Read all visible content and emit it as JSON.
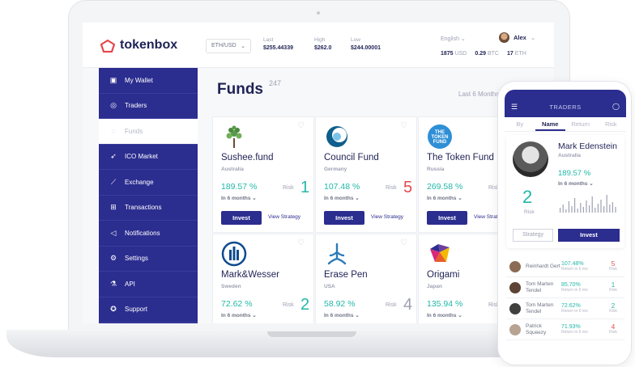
{
  "app": {
    "logo_text": "tokenbox"
  },
  "topbar": {
    "currency_pair": "ETH/USD",
    "stats": [
      {
        "label": "Last",
        "value": "$255.44339"
      },
      {
        "label": "High",
        "value": "$262.0"
      },
      {
        "label": "Low",
        "value": "$244.00001"
      }
    ],
    "language": "English",
    "user_name": "Alex",
    "balances": [
      {
        "amount": "1875",
        "unit": "USD"
      },
      {
        "amount": "0.29",
        "unit": "BTC"
      },
      {
        "amount": "17",
        "unit": "ETH"
      }
    ]
  },
  "sidebar": {
    "items": [
      {
        "label": "My Wallet",
        "icon": "wallet-icon",
        "glyph": "▣"
      },
      {
        "label": "Traders",
        "icon": "target-icon",
        "glyph": "◎"
      },
      {
        "label": "Funds",
        "icon": "funds-icon",
        "glyph": "◌"
      },
      {
        "label": "ICO Market",
        "icon": "rocket-icon",
        "glyph": "➶"
      },
      {
        "label": "Exchange",
        "icon": "chart-icon",
        "glyph": "⟋"
      },
      {
        "label": "Transactions",
        "icon": "signpost-icon",
        "glyph": "⊞"
      },
      {
        "label": "Notifications",
        "icon": "megaphone-icon",
        "glyph": "◁"
      },
      {
        "label": "Settings",
        "icon": "gear-icon",
        "glyph": "⚙"
      },
      {
        "label": "API",
        "icon": "flask-icon",
        "glyph": "⚗"
      },
      {
        "label": "Support",
        "icon": "lifebuoy-icon",
        "glyph": "✪"
      }
    ],
    "active_index": 2
  },
  "main": {
    "title": "Funds",
    "count": "247",
    "period": "Last 6 Months",
    "invest_label": "Invest",
    "view_strategy_label": "View Strategy",
    "risk_label": "Risk",
    "funds": [
      {
        "name": "Sushee.fund",
        "country": "Australia",
        "return": "189.57 %",
        "period": "In 6 months",
        "risk": "1",
        "risk_color": "#22b8a8",
        "logo": "tree-logo"
      },
      {
        "name": "Council Fund",
        "country": "Germany",
        "return": "107.48 %",
        "period": "In 6 months",
        "risk": "5",
        "risk_color": "#e5484d",
        "logo": "council-logo"
      },
      {
        "name": "The Token Fund",
        "country": "Russia",
        "return": "269.58 %",
        "period": "In 6 months",
        "risk": "",
        "risk_color": "#22b8a8",
        "logo": "tokenfund-logo"
      },
      {
        "name": "Mark&Wesser",
        "country": "Sweden",
        "return": "72.62 %",
        "period": "In 6 months",
        "risk": "2",
        "risk_color": "#22b8a8",
        "logo": "allianz-logo"
      },
      {
        "name": "Erase Pen",
        "country": "USA",
        "return": "58.92 %",
        "period": "In 6 months",
        "risk": "4",
        "risk_color": "#9ea1b2",
        "logo": "erasepen-logo"
      },
      {
        "name": "Origami",
        "country": "Japan",
        "return": "135.94 %",
        "period": "In 6 months",
        "risk": "",
        "risk_color": "#22b8a8",
        "logo": "origami-logo"
      }
    ]
  },
  "phone": {
    "header_title": "TRADERS",
    "tabs": [
      "By",
      "Name",
      "Return",
      "Risk"
    ],
    "active_tab": 1,
    "featured": {
      "name": "Mark Edenstein",
      "country": "Australia",
      "return": "189.57 %",
      "period": "In 6 months",
      "risk": "2",
      "risk_label": "Risk",
      "strategy_label": "Strategy",
      "invest_label": "Invest",
      "activity": [
        6,
        10,
        4,
        14,
        8,
        18,
        5,
        12,
        7,
        15,
        9,
        20,
        6,
        11,
        16,
        8,
        22,
        10,
        13,
        7
      ]
    },
    "return_sub": "Return in 6 mo",
    "risk_sub": "Risk",
    "list": [
      {
        "name": "Reinhardt Gert",
        "return": "107.48%",
        "risk": "5",
        "risk_color": "#e5484d"
      },
      {
        "name": "Tom Marten Tendel",
        "return": "85.70%",
        "risk": "1",
        "risk_color": "#22b8a8"
      },
      {
        "name": "Tom Marten Tendel",
        "return": "72.62%",
        "risk": "2",
        "risk_color": "#22b8a8"
      },
      {
        "name": "Patrick Squeezy",
        "return": "71.93%",
        "risk": "4",
        "risk_color": "#e5484d"
      }
    ]
  }
}
